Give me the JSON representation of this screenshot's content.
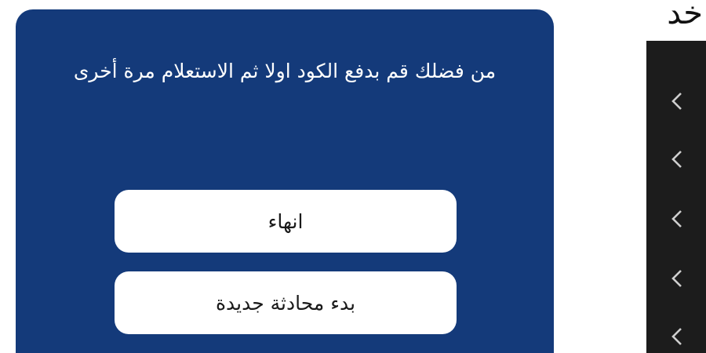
{
  "dialog": {
    "message": "من فضلك قم بدفع الكود اولا ثم الاستعلام مرة أخرى",
    "end_button_label": "انهاء",
    "new_chat_button_label": "بدء محادثة جديدة",
    "background_color": "#143a7a"
  },
  "side_panel": {
    "title_fragment": "خد",
    "item_icon": "chevron-left-icon",
    "item_count": 5
  }
}
